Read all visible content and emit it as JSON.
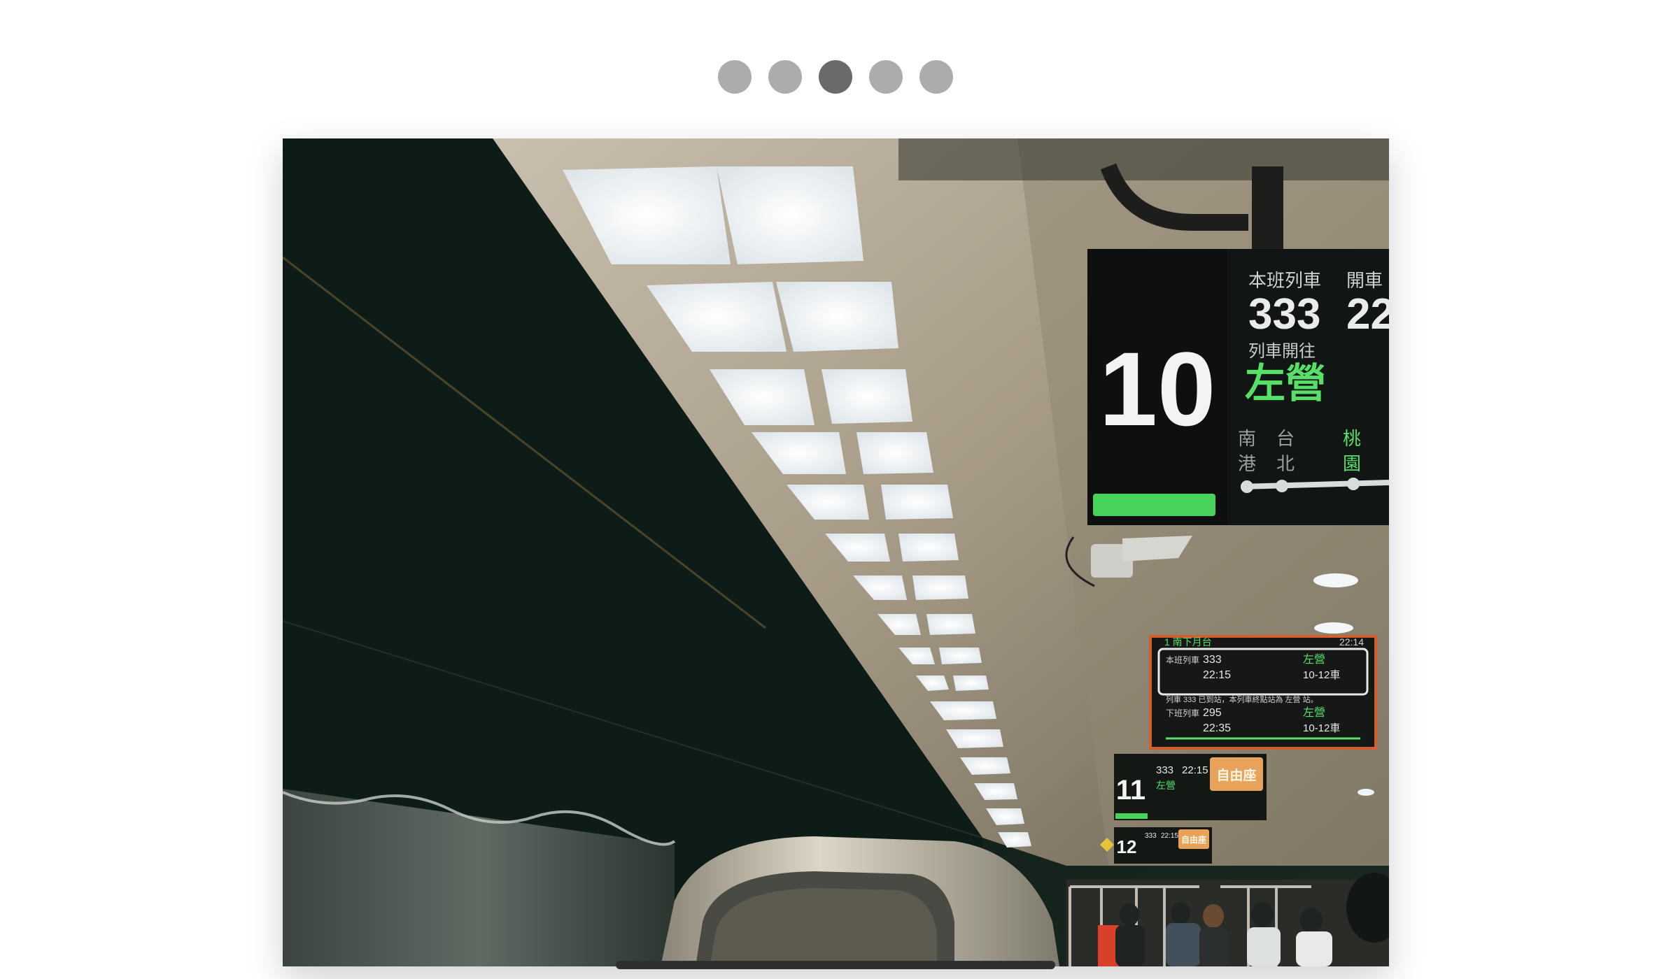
{
  "carousel": {
    "dots": [
      {
        "active": false
      },
      {
        "active": false
      },
      {
        "active": true
      },
      {
        "active": false
      },
      {
        "active": false
      }
    ]
  },
  "photo": {
    "signs": {
      "main": {
        "platform_number": "10",
        "train_label": "本班列車",
        "train_number": "333",
        "next_label": "開車",
        "next_number": "22",
        "destination_label": "列車開往",
        "destination": "左營",
        "stations_1": [
          "南",
          "台",
          "桃"
        ],
        "stations_2": [
          "港",
          "北",
          "園"
        ]
      },
      "second": {
        "header": "1 南下月台",
        "clock": "22:14",
        "row1_label": "本班列車",
        "row1_train": "333",
        "row1_time": "22:15",
        "row1_dest": "左營",
        "row1_cars": "10-12車",
        "ticker": "列車 333 已到站，本列車終點站為 左營 站。",
        "row2_label": "下班列車",
        "row2_train": "295",
        "row2_time": "22:35",
        "row2_dest": "左營",
        "row2_cars": "10-12車"
      },
      "third": {
        "platform_number": "11",
        "train": "333",
        "time": "22:15",
        "dest": "左營",
        "badge": "自由座"
      },
      "fourth": {
        "platform_number": "12",
        "train": "333",
        "time": "22:15",
        "badge": "自由座"
      }
    }
  },
  "colors": {
    "dot_inactive": "#acacac",
    "dot_active": "#6a6a6a",
    "sign_green": "#47d35a",
    "badge_orange": "#e8a35a"
  }
}
